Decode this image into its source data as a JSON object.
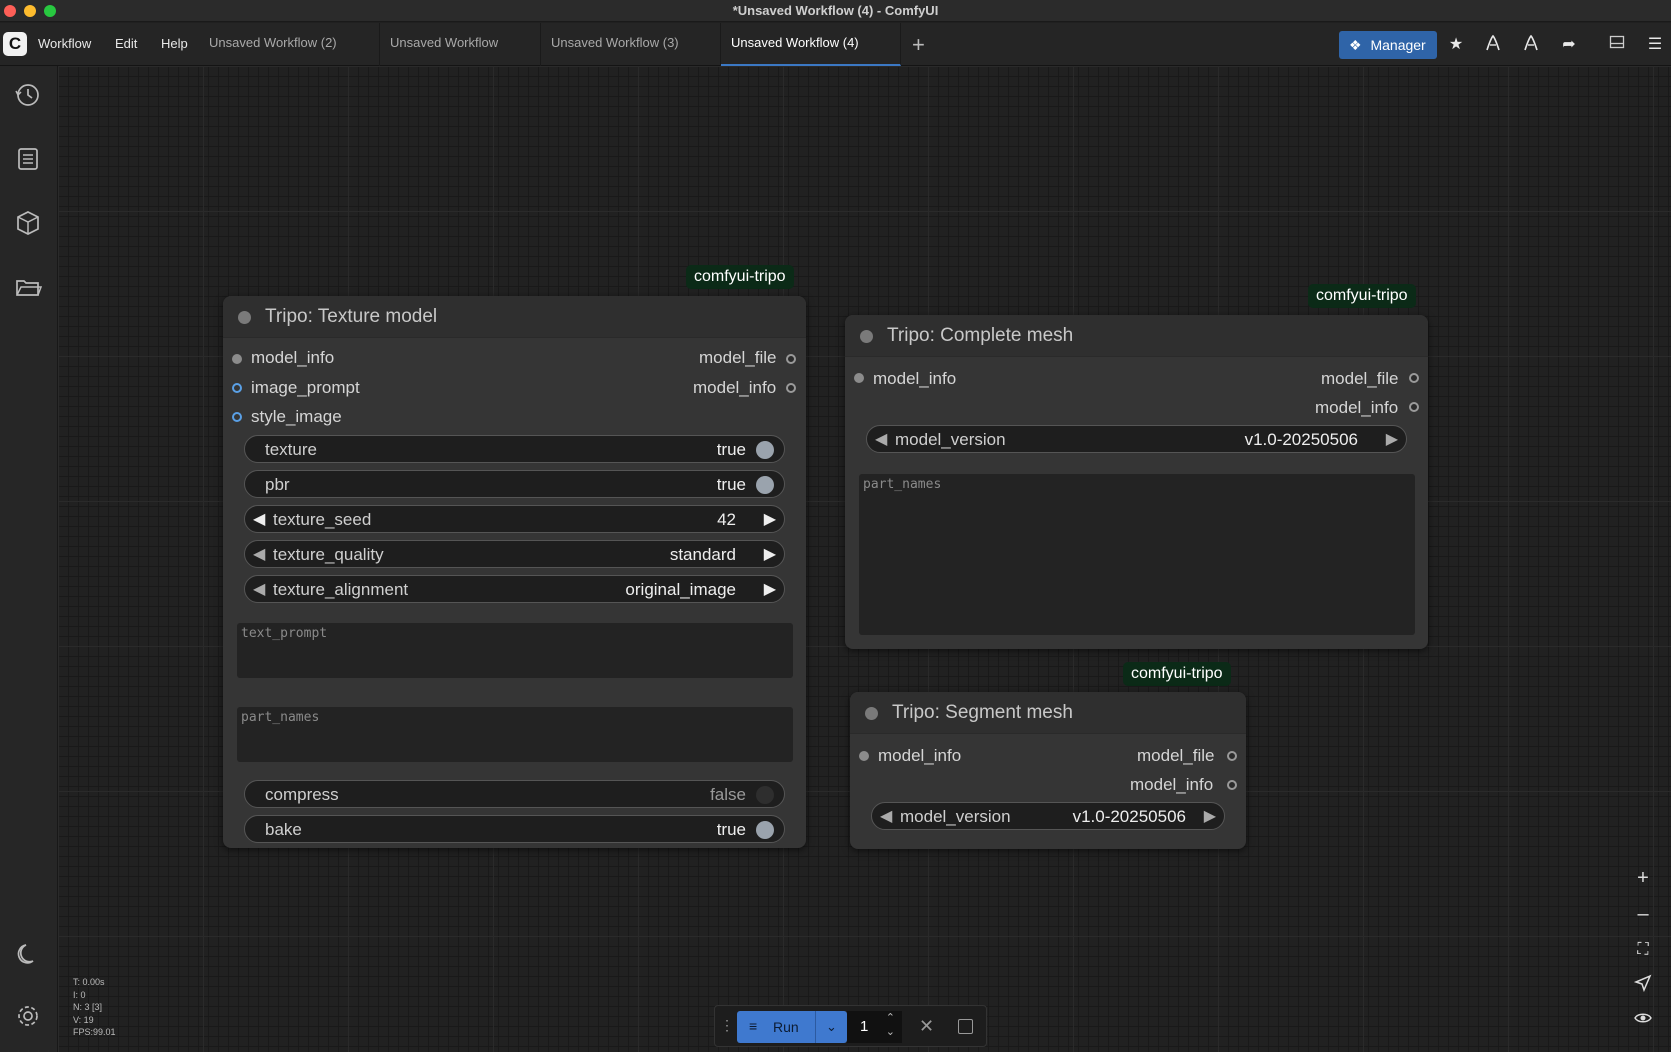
{
  "window": {
    "title": "*Unsaved Workflow (4) - ComfyUI"
  },
  "menu": {
    "logo": "C",
    "workflow": "Workflow",
    "edit": "Edit",
    "help": "Help"
  },
  "tabs": [
    {
      "label": "Unsaved Workflow (2)"
    },
    {
      "label": "Unsaved Workflow"
    },
    {
      "label": "Unsaved Workflow (3)"
    },
    {
      "label": "Unsaved Workflow (4)"
    }
  ],
  "toolbar": {
    "manager_label": "Manager"
  },
  "nodes": {
    "texture": {
      "badge": "comfyui-tripo",
      "title": "Tripo: Texture model",
      "inputs": [
        "model_info",
        "image_prompt",
        "style_image"
      ],
      "outputs": [
        "model_file",
        "model_info"
      ],
      "widgets": {
        "texture": {
          "label": "texture",
          "value": "true"
        },
        "pbr": {
          "label": "pbr",
          "value": "true"
        },
        "texture_seed": {
          "label": "texture_seed",
          "value": "42"
        },
        "texture_quality": {
          "label": "texture_quality",
          "value": "standard"
        },
        "texture_alignment": {
          "label": "texture_alignment",
          "value": "original_image"
        },
        "compress": {
          "label": "compress",
          "value": "false"
        },
        "bake": {
          "label": "bake",
          "value": "true"
        }
      },
      "text_prompt_placeholder": "text_prompt",
      "part_names_placeholder": "part_names"
    },
    "complete": {
      "badge": "comfyui-tripo",
      "title": "Tripo: Complete mesh",
      "inputs": [
        "model_info"
      ],
      "outputs": [
        "model_file",
        "model_info"
      ],
      "model_version": {
        "label": "model_version",
        "value": "v1.0-20250506"
      },
      "part_names_placeholder": "part_names"
    },
    "segment": {
      "badge": "comfyui-tripo",
      "title": "Tripo: Segment mesh",
      "inputs": [
        "model_info"
      ],
      "outputs": [
        "model_file",
        "model_info"
      ],
      "model_version": {
        "label": "model_version",
        "value": "v1.0-20250506"
      }
    }
  },
  "stats": {
    "t": "T: 0.00s",
    "i": "I: 0",
    "n": "N: 3 [3]",
    "v": "V: 19",
    "fps": "FPS:99.01"
  },
  "runbar": {
    "run_label": "Run",
    "queue_count": "1"
  }
}
